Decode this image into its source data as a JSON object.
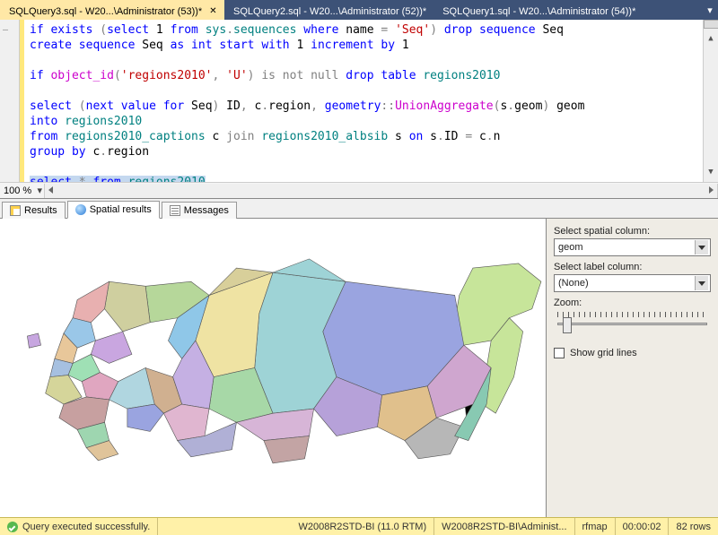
{
  "tabs": [
    {
      "label": "SQLQuery3.sql - W20...\\Administrator (53))*",
      "active": true
    },
    {
      "label": "SQLQuery2.sql - W20...\\Administrator (52))*",
      "active": false
    },
    {
      "label": "SQLQuery1.sql - W20...\\Administrator (54))*",
      "active": false
    }
  ],
  "editor": {
    "zoom": "100 %",
    "lines": [
      [
        {
          "t": "if",
          "c": "kw"
        },
        {
          "t": " "
        },
        {
          "t": "exists",
          "c": "kw"
        },
        {
          "t": " "
        },
        {
          "t": "(",
          "c": "gray"
        },
        {
          "t": "select",
          "c": "kw"
        },
        {
          "t": " 1 "
        },
        {
          "t": "from",
          "c": "kw"
        },
        {
          "t": " "
        },
        {
          "t": "sys",
          "c": "sys"
        },
        {
          "t": ".",
          "c": "gray"
        },
        {
          "t": "sequences",
          "c": "sys"
        },
        {
          "t": " "
        },
        {
          "t": "where",
          "c": "kw"
        },
        {
          "t": " name "
        },
        {
          "t": "=",
          "c": "gray"
        },
        {
          "t": " "
        },
        {
          "t": "'Seq'",
          "c": "str"
        },
        {
          "t": ")",
          "c": "gray"
        },
        {
          "t": " "
        },
        {
          "t": "drop",
          "c": "kw"
        },
        {
          "t": " "
        },
        {
          "t": "sequence",
          "c": "kw"
        },
        {
          "t": " Seq"
        }
      ],
      [
        {
          "t": "create",
          "c": "kw"
        },
        {
          "t": " "
        },
        {
          "t": "sequence",
          "c": "kw"
        },
        {
          "t": " Seq "
        },
        {
          "t": "as",
          "c": "kw"
        },
        {
          "t": " "
        },
        {
          "t": "int",
          "c": "kw"
        },
        {
          "t": " "
        },
        {
          "t": "start",
          "c": "kw"
        },
        {
          "t": " "
        },
        {
          "t": "with",
          "c": "kw"
        },
        {
          "t": " 1 "
        },
        {
          "t": "increment",
          "c": "kw"
        },
        {
          "t": " "
        },
        {
          "t": "by",
          "c": "kw"
        },
        {
          "t": " 1"
        }
      ],
      [],
      [
        {
          "t": "if",
          "c": "kw"
        },
        {
          "t": " "
        },
        {
          "t": "object_id",
          "c": "fn"
        },
        {
          "t": "(",
          "c": "gray"
        },
        {
          "t": "'regions2010'",
          "c": "str"
        },
        {
          "t": ",",
          "c": "gray"
        },
        {
          "t": " "
        },
        {
          "t": "'U'",
          "c": "str"
        },
        {
          "t": ")",
          "c": "gray"
        },
        {
          "t": " "
        },
        {
          "t": "is",
          "c": "gray"
        },
        {
          "t": " "
        },
        {
          "t": "not",
          "c": "gray"
        },
        {
          "t": " "
        },
        {
          "t": "null",
          "c": "gray"
        },
        {
          "t": " "
        },
        {
          "t": "drop",
          "c": "kw"
        },
        {
          "t": " "
        },
        {
          "t": "table",
          "c": "kw"
        },
        {
          "t": " "
        },
        {
          "t": "regions2010",
          "c": "sys"
        }
      ],
      [],
      [
        {
          "t": "select",
          "c": "kw"
        },
        {
          "t": " "
        },
        {
          "t": "(",
          "c": "gray"
        },
        {
          "t": "next",
          "c": "kw"
        },
        {
          "t": " "
        },
        {
          "t": "value",
          "c": "kw"
        },
        {
          "t": " "
        },
        {
          "t": "for",
          "c": "kw"
        },
        {
          "t": " Seq"
        },
        {
          "t": ")",
          "c": "gray"
        },
        {
          "t": " ID"
        },
        {
          "t": ",",
          "c": "gray"
        },
        {
          "t": " c"
        },
        {
          "t": ".",
          "c": "gray"
        },
        {
          "t": "region"
        },
        {
          "t": ",",
          "c": "gray"
        },
        {
          "t": " "
        },
        {
          "t": "geometry",
          "c": "kw"
        },
        {
          "t": "::",
          "c": "gray"
        },
        {
          "t": "UnionAggregate",
          "c": "fn"
        },
        {
          "t": "(",
          "c": "gray"
        },
        {
          "t": "s"
        },
        {
          "t": ".",
          "c": "gray"
        },
        {
          "t": "geom"
        },
        {
          "t": ")",
          "c": "gray"
        },
        {
          "t": " geom"
        }
      ],
      [
        {
          "t": "into",
          "c": "kw"
        },
        {
          "t": " "
        },
        {
          "t": "regions2010",
          "c": "sys"
        }
      ],
      [
        {
          "t": "from",
          "c": "kw"
        },
        {
          "t": " "
        },
        {
          "t": "regions2010_captions",
          "c": "sys"
        },
        {
          "t": " c "
        },
        {
          "t": "join",
          "c": "gray"
        },
        {
          "t": " "
        },
        {
          "t": "regions2010_albsib",
          "c": "sys"
        },
        {
          "t": " s "
        },
        {
          "t": "on",
          "c": "kw"
        },
        {
          "t": " s"
        },
        {
          "t": ".",
          "c": "gray"
        },
        {
          "t": "ID "
        },
        {
          "t": "=",
          "c": "gray"
        },
        {
          "t": " c"
        },
        {
          "t": ".",
          "c": "gray"
        },
        {
          "t": "n"
        }
      ],
      [
        {
          "t": "group",
          "c": "kw"
        },
        {
          "t": " "
        },
        {
          "t": "by",
          "c": "kw"
        },
        {
          "t": " c"
        },
        {
          "t": ".",
          "c": "gray"
        },
        {
          "t": "region"
        }
      ],
      [],
      [
        {
          "t": "select",
          "c": "kw",
          "sel": true
        },
        {
          "t": " ",
          "sel": true
        },
        {
          "t": "*",
          "c": "gray",
          "sel": true
        },
        {
          "t": " ",
          "sel": true
        },
        {
          "t": "from",
          "c": "kw",
          "sel": true
        },
        {
          "t": " ",
          "sel": true
        },
        {
          "t": "regions2010",
          "c": "sys",
          "sel": true
        }
      ]
    ]
  },
  "result_tabs": [
    {
      "label": "Results",
      "icon": "grid",
      "active": false
    },
    {
      "label": "Spatial results",
      "icon": "globe",
      "active": true
    },
    {
      "label": "Messages",
      "icon": "msg",
      "active": false
    }
  ],
  "side_panel": {
    "spatial_label": "Select spatial column:",
    "spatial_value": "geom",
    "label_label": "Select label column:",
    "label_value": "(None)",
    "zoom_label": "Zoom:",
    "grid_label": "Show grid lines",
    "grid_checked": false
  },
  "status": {
    "message": "Query executed successfully.",
    "server": "W2008R2STD-BI (11.0 RTM)",
    "user": "W2008R2STD-BI\\Administ...",
    "db": "rfmap",
    "elapsed": "00:00:02",
    "rows": "82 rows"
  }
}
